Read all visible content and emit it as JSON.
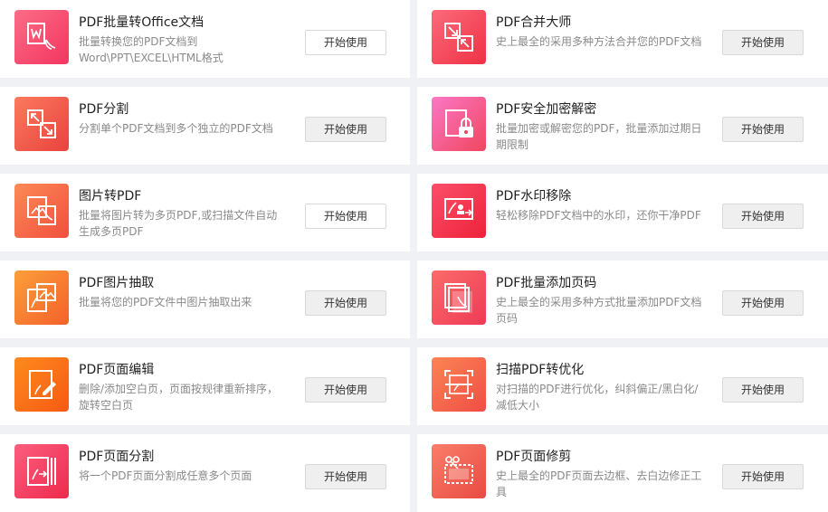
{
  "cards": [
    {
      "title": "PDF批量转Office文档",
      "desc": "批量转换您的PDF文档到Word\\PPT\\EXCEL\\HTML格式",
      "button": "开始使用",
      "icon": "pdf-to-word-icon",
      "grad": [
        "#fb6d86",
        "#f3355f"
      ],
      "btn_hover": false
    },
    {
      "title": "PDF合并大师",
      "desc": "史上最全的采用多种方法合并您的PDF文档",
      "button": "开始使用",
      "icon": "merge-icon",
      "grad": [
        "#fb6b7a",
        "#ef3145"
      ],
      "btn_hover": true
    },
    {
      "title": "PDF分割",
      "desc": "分割单个PDF文档到多个独立的PDF文档",
      "button": "开始使用",
      "icon": "split-icon",
      "grad": [
        "#fb7a5e",
        "#e9423d"
      ],
      "btn_hover": true
    },
    {
      "title": "PDF安全加密解密",
      "desc": "批量加密或解密您的PDF，批量添加过期日期限制",
      "button": "开始使用",
      "icon": "lock-icon",
      "grad": [
        "#fb78c6",
        "#f0465d"
      ],
      "btn_hover": true
    },
    {
      "title": "图片转PDF",
      "desc": "批量将图片转为多页PDF,或扫描文件自动生成多页PDF",
      "button": "开始使用",
      "icon": "image-to-pdf-icon",
      "grad": [
        "#fc8a57",
        "#f14f3d"
      ],
      "btn_hover": false
    },
    {
      "title": "PDF水印移除",
      "desc": "轻松移除PDF文档中的水印，还你干净PDF",
      "button": "开始使用",
      "icon": "watermark-remove-icon",
      "grad": [
        "#fb4f6a",
        "#ee223a"
      ],
      "btn_hover": true
    },
    {
      "title": "PDF图片抽取",
      "desc": "批量将您的PDF文件中图片抽取出来",
      "button": "开始使用",
      "icon": "image-extract-icon",
      "grad": [
        "#fb9f3a",
        "#f4612a"
      ],
      "btn_hover": true
    },
    {
      "title": "PDF批量添加页码",
      "desc": "史上最全的采用多种方式批量添加PDF文档页码",
      "button": "开始使用",
      "icon": "page-number-icon",
      "grad": [
        "#fb6b6b",
        "#ee3b55"
      ],
      "btn_hover": true
    },
    {
      "title": "PDF页面编辑",
      "desc": "删除/添加空白页，页面按规律重新排序，旋转空白页",
      "button": "开始使用",
      "icon": "page-edit-icon",
      "grad": [
        "#fd8a1e",
        "#f65a12"
      ],
      "btn_hover": true
    },
    {
      "title": "扫描PDF转优化",
      "desc": "对扫描的PDF进行优化，纠斜偏正/黑白化/减低大小",
      "button": "开始使用",
      "icon": "scan-optimize-icon",
      "grad": [
        "#fb8554",
        "#f04d45"
      ],
      "btn_hover": true
    },
    {
      "title": "PDF页面分割",
      "desc": "将一个PDF页面分割成任意多个页面",
      "button": "开始使用",
      "icon": "page-split-icon",
      "grad": [
        "#fb5e7e",
        "#ee2a4d"
      ],
      "btn_hover": true
    },
    {
      "title": "PDF页面修剪",
      "desc": "史上最全的PDF页面去边框、去白边修正工具",
      "button": "开始使用",
      "icon": "page-crop-icon",
      "grad": [
        "#f97e6a",
        "#e94a42"
      ],
      "btn_hover": true
    }
  ]
}
